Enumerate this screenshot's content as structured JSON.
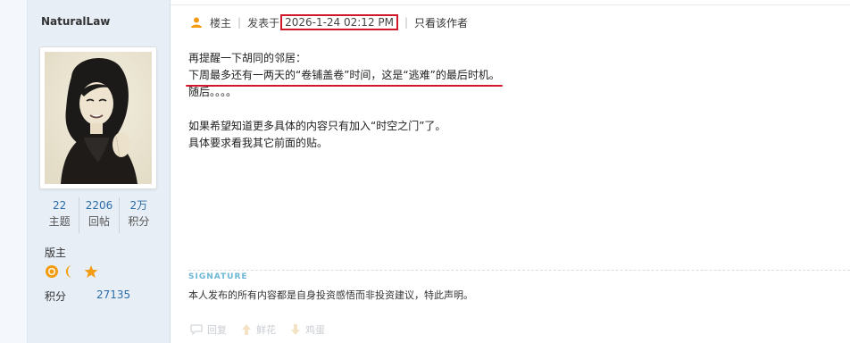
{
  "user": {
    "name": "NaturalLaw",
    "stats": [
      {
        "value": "22",
        "label": "主题"
      },
      {
        "value": "2206",
        "label": "回帖"
      },
      {
        "value": "2万",
        "label": "积分"
      }
    ],
    "rank": "版主",
    "points_label": "积分",
    "points_value": "27135"
  },
  "post": {
    "floor": "楼主",
    "posted_label": "发表于",
    "timestamp": "2026-1-24 02:12 PM",
    "only_author": "只看该作者",
    "lines": [
      "再提醒一下胡同的邻居：",
      "下周最多还有一两天的“卷铺盖卷”时间，这是“逃难”的最后时机。",
      "随后。。。。",
      "",
      "如果希望知道更多具体的内容只有加入“时空之门”了。",
      "具体要求看我其它前面的贴。"
    ]
  },
  "signature": {
    "label": "SIGNATURE",
    "text": "本人发布的所有内容都是自身投资感悟而非投资建议，特此声明。"
  },
  "actions": {
    "reply": "回复",
    "flower": "鲜花",
    "egg": "鸡蛋"
  },
  "colors": {
    "accent": "#d0182a",
    "link": "#2b6ca8",
    "sidebar_bg": "#e7eef6",
    "medal_orange": "#f39c12"
  }
}
